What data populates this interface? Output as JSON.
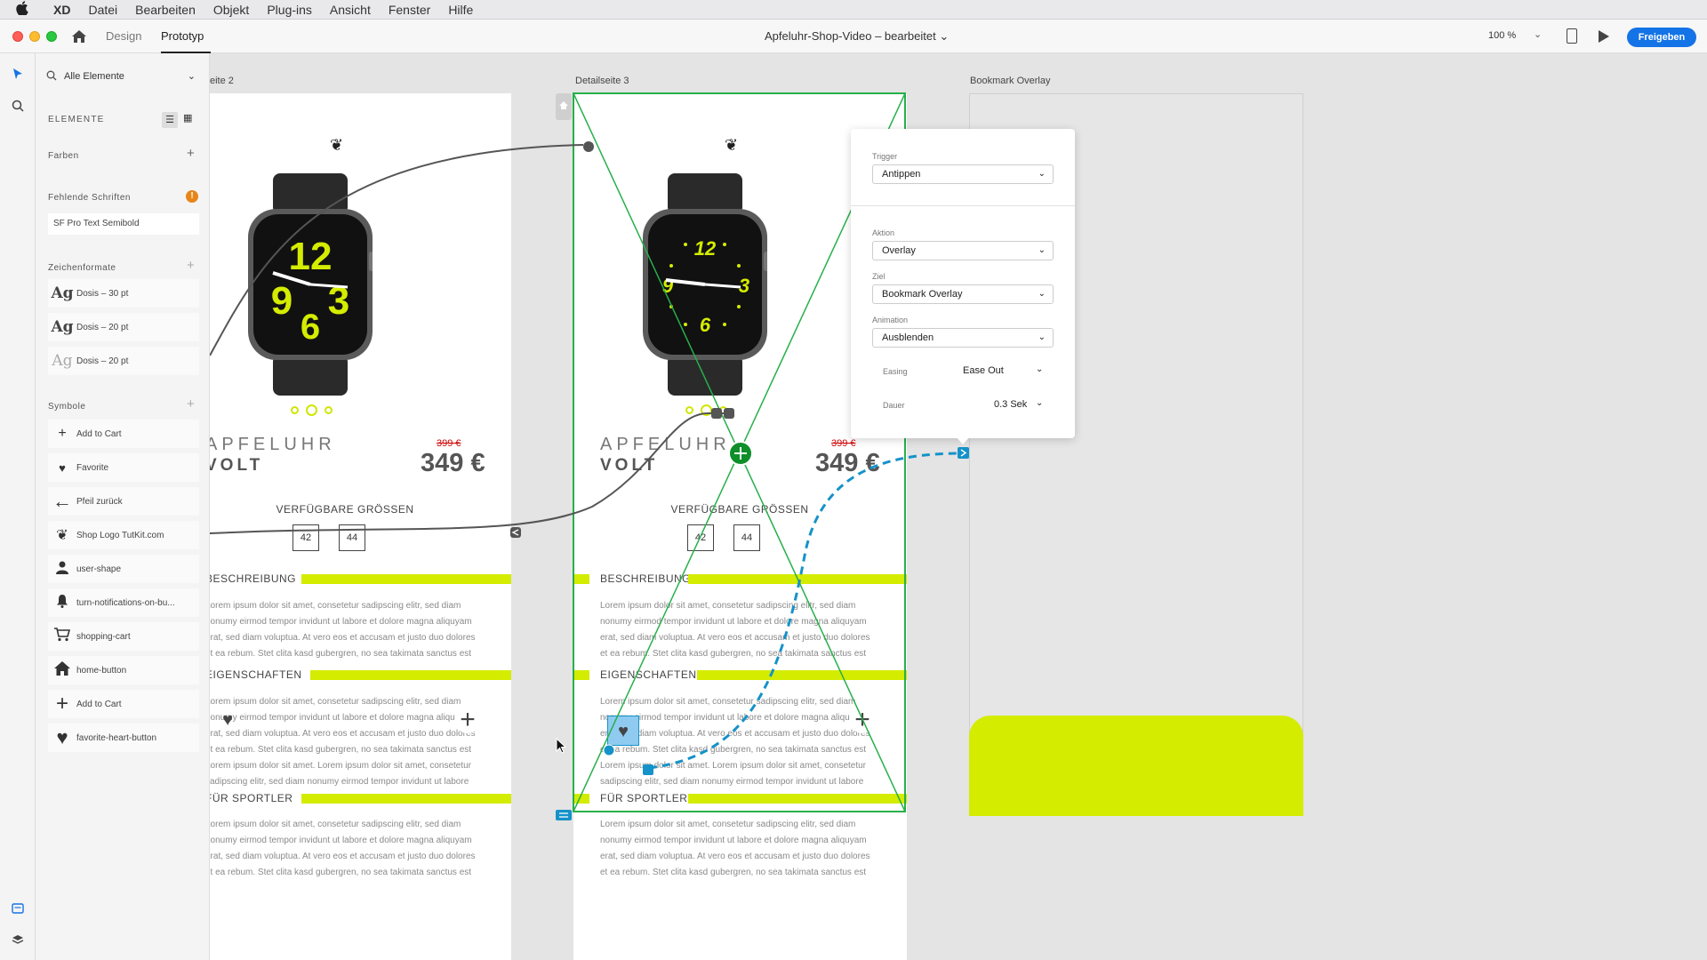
{
  "menubar": {
    "apple": "",
    "app": "XD",
    "items": [
      "Datei",
      "Bearbeiten",
      "Objekt",
      "Plug-ins",
      "Ansicht",
      "Fenster",
      "Hilfe"
    ]
  },
  "titlebar": {
    "tabs": [
      "Design",
      "Prototyp"
    ],
    "active_tab": "Prototyp",
    "document_title": "Apfeluhr-Shop-Video – bearbeitet",
    "document_chevron": "⌄",
    "zoom": "100 %",
    "zoom_chevron": "⌄",
    "share_label": "Freigeben"
  },
  "tools": [
    "select-icon",
    "search-icon",
    "plugins-icon",
    "layers-icon"
  ],
  "panel": {
    "filter_label": "Alle Elemente",
    "filter_chevron": "⌄",
    "elements_title": "ELEMENTE",
    "colors_title": "Farben",
    "missing_fonts_title": "Fehlende Schriften",
    "missing_font": "SF Pro Text Semibold",
    "char_formats_title": "Zeichenformate",
    "char_formats": [
      {
        "glyph": "Ag",
        "label": "Dosis – 30 pt"
      },
      {
        "glyph": "Ag",
        "label": "Dosis – 20 pt"
      },
      {
        "glyph": "Ag",
        "label": "Dosis – 20 pt"
      }
    ],
    "symbols_title": "Symbole",
    "symbols": [
      {
        "icon": "plus-icon",
        "glyph": "+",
        "label": "Add to Cart"
      },
      {
        "icon": "heart-icon",
        "glyph": "♥",
        "label": "Favorite"
      },
      {
        "icon": "arrow-left-icon",
        "glyph": "←",
        "label": "Pfeil zurück"
      },
      {
        "icon": "shop-logo-icon",
        "glyph": "❦",
        "label": "Shop Logo TutKit.com"
      },
      {
        "icon": "user-icon",
        "glyph": "●",
        "label": "user-shape"
      },
      {
        "icon": "bell-icon",
        "glyph": "🔔",
        "label": "turn-notifications-on-bu..."
      },
      {
        "icon": "cart-icon",
        "glyph": "🛒",
        "label": "shopping-cart"
      },
      {
        "icon": "home-icon",
        "glyph": "⌂",
        "label": "home-button"
      },
      {
        "icon": "plus-icon",
        "glyph": "+",
        "label": "Add to Cart"
      },
      {
        "icon": "heart-icon",
        "glyph": "♥",
        "label": "favorite-heart-button"
      }
    ]
  },
  "canvas": {
    "artboards": [
      {
        "id": "left",
        "label": "eite 2"
      },
      {
        "id": "detail3",
        "label": "Detailseite 3"
      },
      {
        "id": "overlay",
        "label": "Bookmark Overlay"
      }
    ],
    "product": {
      "logo": "❦",
      "name_line1": "APFELUHR",
      "name_line2": "VOLT",
      "name_line1_clipped": "PFELUHR",
      "name_line2_clipped": "OLT",
      "old_price": "399 €",
      "price": "349 €",
      "sizes_title": "VERFÜGBARE GRÖSSEN",
      "sizes": [
        "42",
        "44"
      ],
      "sections": [
        {
          "title": "BESCHREIBUNG",
          "title_clipped": "ESCHREIBUNG"
        },
        {
          "title": "EIGENSCHAFTEN",
          "title_clipped": "IGENSCHAFTEN"
        },
        {
          "title": "FÜR SPORTLER",
          "title_clipped": "ÜR SPORTLER"
        }
      ],
      "lorem_short": [
        "Lorem ipsum dolor sit amet, consetetur sadipscing elitr, sed diam",
        "nonumy eirmod tempor invidunt ut labore et dolore magna aliquyam",
        "erat, sed diam voluptua. At vero eos et accusam et justo duo dolores",
        "et ea rebum. Stet clita kasd gubergren, no sea takimata sanctus est"
      ],
      "lorem_long": [
        "Lorem ipsum dolor sit amet, consetetur sadipscing elitr, sed diam",
        "nonumy eirmod tempor invidunt ut labore et dolore magna aliquyam",
        "erat, sed diam voluptua. At vero eos et accusam et justo duo dolores",
        "et ea rebum. Stet clita kasd gubergren, no sea takimata sanctus est",
        "Lorem ipsum dolor sit amet. Lorem ipsum dolor sit amet, consetetur",
        "sadipscing elitr, sed diam nonumy eirmod tempor invidunt ut labore"
      ],
      "lorem_left_short": [
        "orem ipsum dolor sit amet, consetetur sadipscing elitr, sed diam",
        "onumy eirmod tempor invidunt ut labore et dolore magna aliquyam",
        "rat, sed diam voluptua. At vero eos et accusam et justo duo dolores",
        "ea rebum. Stet clita kasd gubergren, no sea takimata sanctus est"
      ],
      "lorem_left_long": [
        "orem ipsum dolor sit amet, consetetur sadipscing elitr, sed diam",
        "mod tempor invidunt ut labore et dolore magna a",
        "rat, sed diam voluptua. At vero eos et accusam et justo duo dolores",
        "ea rebum. Stet clita kasd gubergren, no sea takimata sanctus est",
        "orem ipsum dolor sit amet. Lorem ipsum dolor sit amet, consetetur",
        "adipscing elitr, sed diam nonumy eirmod tempor invidunt ut labore"
      ]
    },
    "watch_faces": {
      "left": {
        "n12": "12",
        "n9": "9",
        "n6": "6",
        "n3": "3"
      },
      "right": {
        "n12": "12",
        "n9": "9",
        "n6": "6",
        "n3": "3"
      }
    }
  },
  "interaction_popup": {
    "trigger_label": "Trigger",
    "trigger_value": "Antippen",
    "action_label": "Aktion",
    "action_value": "Overlay",
    "target_label": "Ziel",
    "target_value": "Bookmark Overlay",
    "animation_label": "Animation",
    "animation_value": "Ausblenden",
    "easing_label": "Easing",
    "easing_value": "Ease Out",
    "duration_label": "Dauer",
    "duration_value": "0.3 Sek",
    "chevron": "⌄"
  },
  "colors": {
    "accent_lime": "#d4ec00",
    "share_blue": "#1473e6",
    "selection_green": "#27b04a",
    "wire_blue": "#1592c9"
  }
}
